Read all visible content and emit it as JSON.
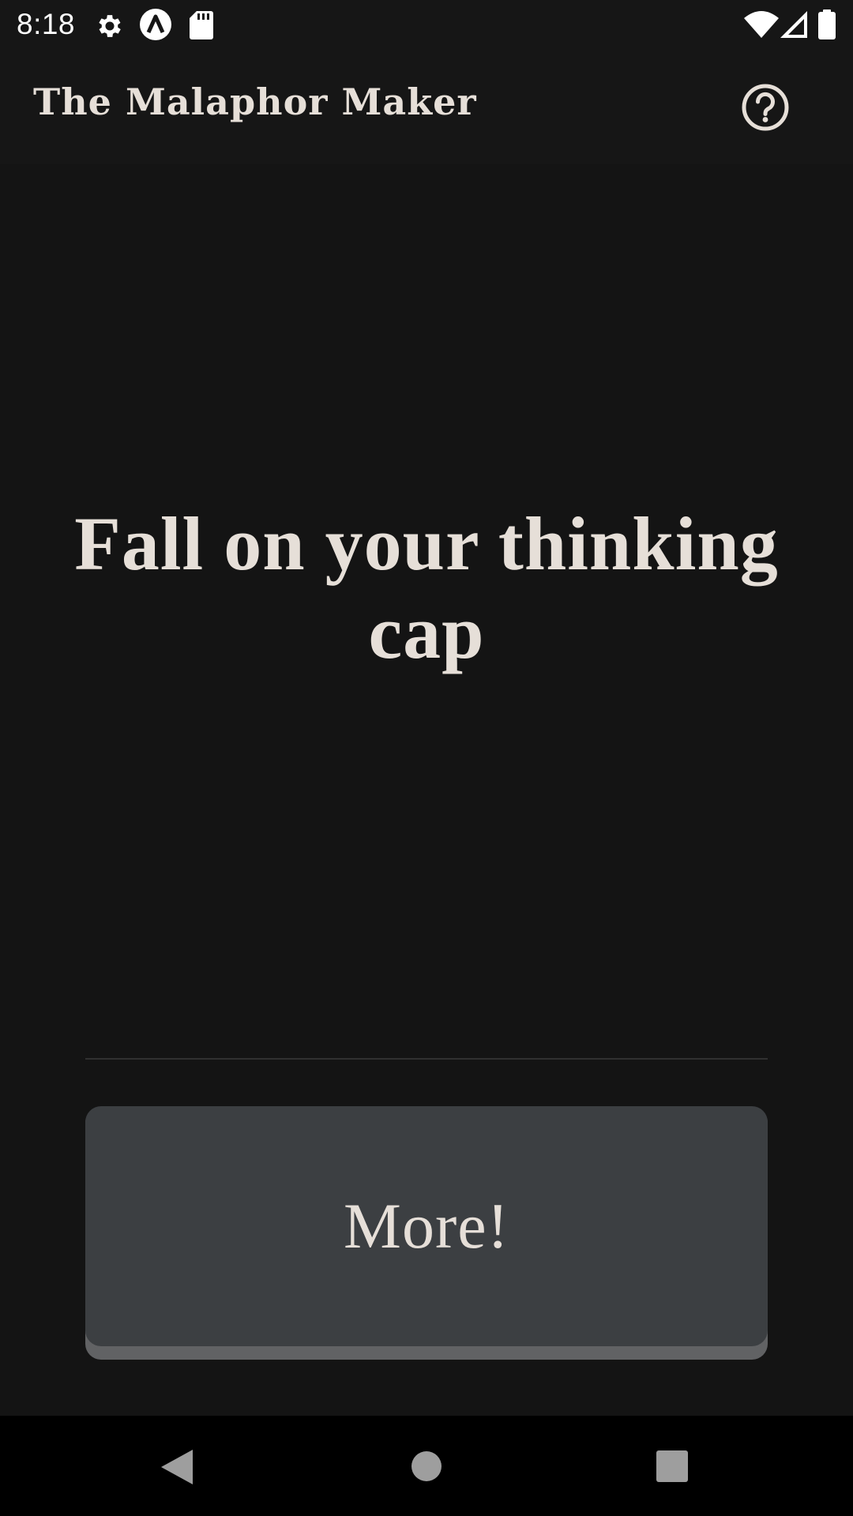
{
  "status_bar": {
    "time": "8:18",
    "icons": [
      "settings-gear-icon",
      "app-a-icon",
      "sd-card-icon",
      "wifi-icon",
      "signal-icon",
      "battery-icon"
    ]
  },
  "app_bar": {
    "title": "The Malaphor Maker",
    "help_icon": "help-circle-icon"
  },
  "main": {
    "malaphor": "Fall on your thinking cap",
    "more_button_label": "More!"
  },
  "nav_bar": {
    "icons": [
      "back-triangle-icon",
      "home-circle-icon",
      "recents-square-icon"
    ]
  },
  "colors": {
    "background": "#141414",
    "text": "#e6dfd8",
    "button": "#3c3f42",
    "button_shadow": "#616264"
  }
}
